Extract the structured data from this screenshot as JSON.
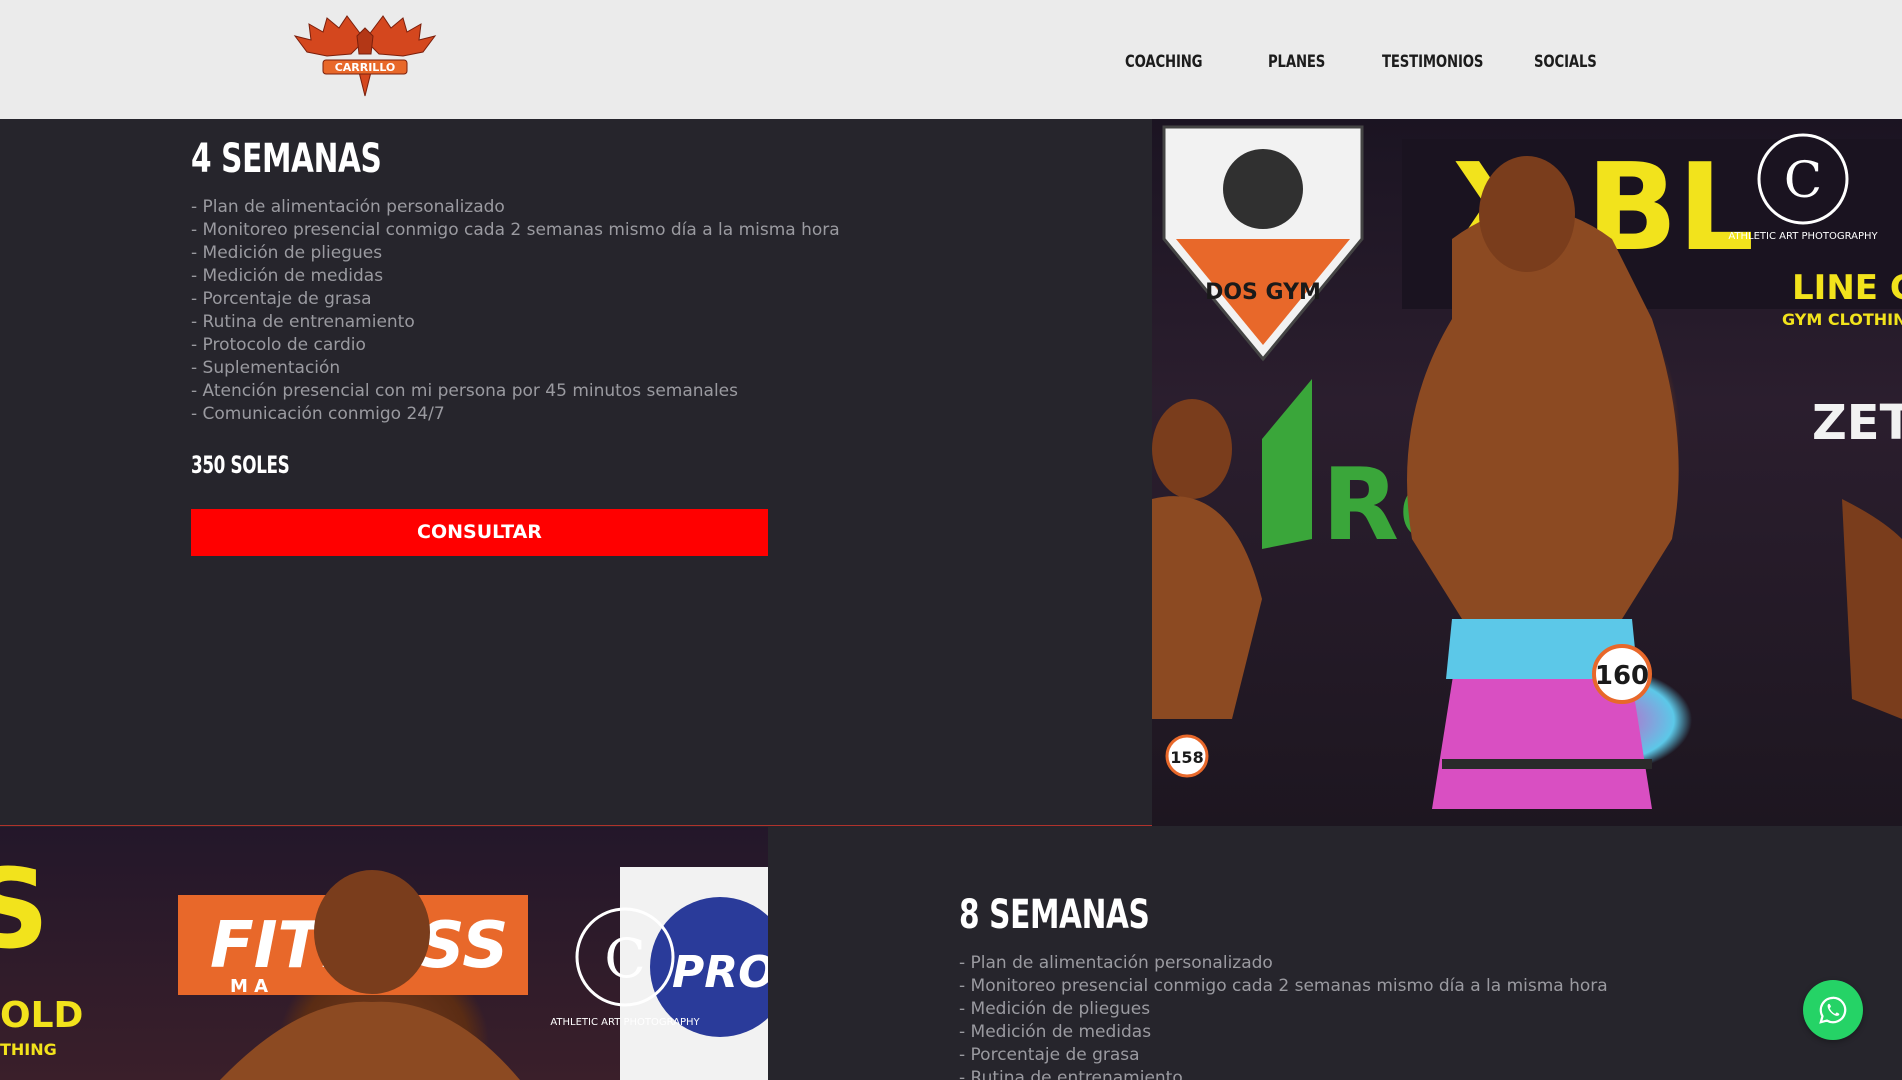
{
  "header": {
    "logo_text": "CARRILLO",
    "nav": [
      {
        "label": "COACHING"
      },
      {
        "label": "PLANES"
      },
      {
        "label": "TESTIMONIOS"
      },
      {
        "label": "SOCIALS"
      }
    ]
  },
  "plan1": {
    "title": "4 SEMANAS",
    "features": [
      "- Plan de alimentación personalizado",
      "- Monitoreo presencial conmigo cada 2 semanas mismo día a la misma hora",
      "- Medición de pliegues",
      "- Medición de medidas",
      "- Porcentaje de grasa",
      "- Rutina de entrenamiento",
      "- Protocolo de cardio",
      "- Suplementación",
      "- Atención presencial con mi persona por 45 minutos semanales",
      "- Comunicación conmigo 24/7"
    ],
    "price": "350 SOLES",
    "button_label": "CONSULTAR",
    "photo": {
      "watermark": "ATHLETIC ART PHOTOGRAPHY",
      "badge_number": "160",
      "badge_number_2": "158",
      "sign_gym": "DOS GYM",
      "sign_brand": "LINE GOLD",
      "sign_brand_sub": "GYM CLOTHING",
      "sign_partial": "ZETA",
      "sign_re": "Re"
    }
  },
  "plan2": {
    "title": "8 SEMANAS",
    "features": [
      "- Plan de alimentación personalizado",
      "- Monitoreo presencial conmigo cada 2 semanas mismo día a la misma hora",
      "- Medición de pliegues",
      "- Medición de medidas",
      "- Porcentaje de grasa",
      "- Rutina de entrenamiento"
    ],
    "photo": {
      "watermark": "ATHLETIC ART PHOTOGRAPHY",
      "sign_fitness": "FITNESS",
      "sign_fitness_sub": "M A",
      "sign_gold": "OLD",
      "sign_thing": "THING",
      "sign_pro": "PRO-C"
    }
  },
  "colors": {
    "accent": "#ff0000",
    "whatsapp": "#25d366",
    "background": "#26252c",
    "header_bg": "#ebebeb"
  },
  "whatsapp_icon": "whatsapp-icon"
}
